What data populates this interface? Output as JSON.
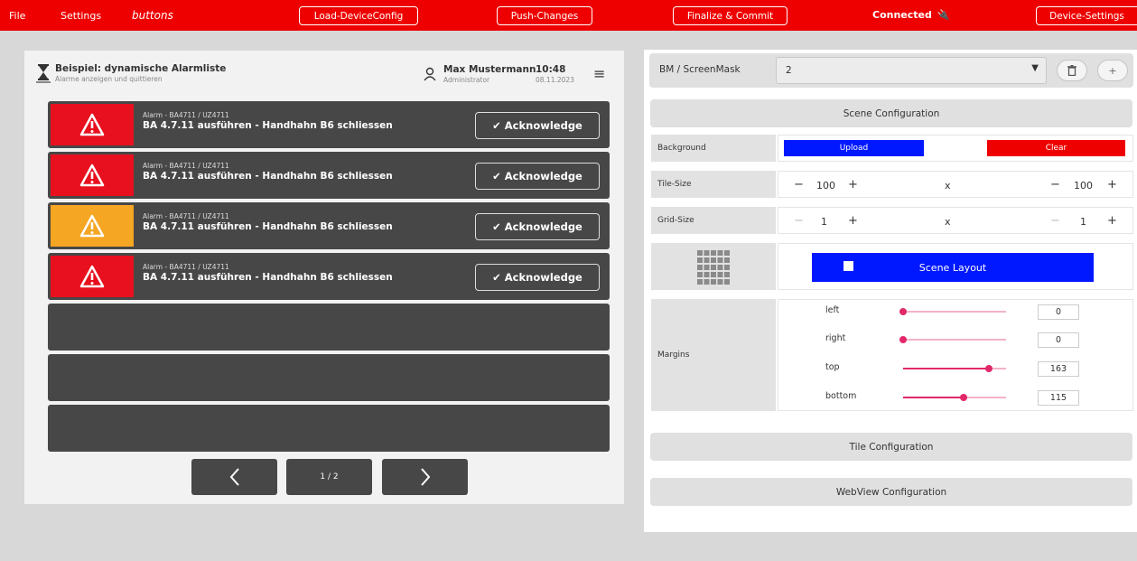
{
  "topbar": {
    "file": "File",
    "settings": "Settings",
    "buttons": "buttons",
    "load": "Load-DeviceConfig",
    "push": "Push-Changes",
    "finalize": "Finalize & Commit",
    "status": "Connected",
    "device": "Device-Settings",
    "colors": {
      "bar": "#ee0000",
      "plug": "#7ae23a"
    }
  },
  "alarmlist": {
    "title": "Beispiel: dynamische Alarmliste",
    "subtitle": "Alarme anzeigen und quittieren",
    "user": "Max Mustermann",
    "role": "Administrator",
    "time": "10:48",
    "date": "08.11.2023",
    "alarms": [
      {
        "sub": "Alarm - BA4711 / UZ4711",
        "text": "BA 4.7.11 ausführen - Handhahn B6 schliessen",
        "severity": "red",
        "ack": "✔  Acknowledge"
      },
      {
        "sub": "Alarm - BA4711 / UZ4711",
        "text": "BA 4.7.11 ausführen - Handhahn B6 schliessen",
        "severity": "red",
        "ack": "✔  Acknowledge"
      },
      {
        "sub": "Alarm - BA4711 / UZ4711",
        "text": "BA 4.7.11 ausführen - Handhahn B6 schliessen",
        "severity": "orange",
        "ack": "✔  Acknowledge"
      },
      {
        "sub": "Alarm - BA4711 / UZ4711",
        "text": "BA 4.7.11 ausführen - Handhahn B6 schliessen",
        "severity": "red",
        "ack": "✔  Acknowledge"
      }
    ],
    "page": "1 / 2",
    "severity_colors": {
      "red": "#e8101e",
      "orange": "#f5a623"
    }
  },
  "panel": {
    "bm_label": "BM / ScreenMask",
    "bm_value": "2",
    "scene_config": "Scene Configuration",
    "background_label": "Background",
    "upload": "Upload",
    "clear": "Clear",
    "tile_size": {
      "label": "Tile-Size",
      "x": "100",
      "x_sep": "x",
      "y": "100"
    },
    "grid_size": {
      "label": "Grid-Size",
      "x": "1",
      "x_sep": "x",
      "y": "1"
    },
    "scene_layout": "Scene Layout",
    "margins_label": "Margins",
    "margins": [
      {
        "name": "left",
        "value": "0",
        "level": 0.0
      },
      {
        "name": "right",
        "value": "0",
        "level": 0.0
      },
      {
        "name": "top",
        "value": "163",
        "level": 0.83
      },
      {
        "name": "bottom",
        "value": "115",
        "level": 0.58
      }
    ],
    "tile_config": "Tile Configuration",
    "webview_config": "WebView Configuration"
  }
}
